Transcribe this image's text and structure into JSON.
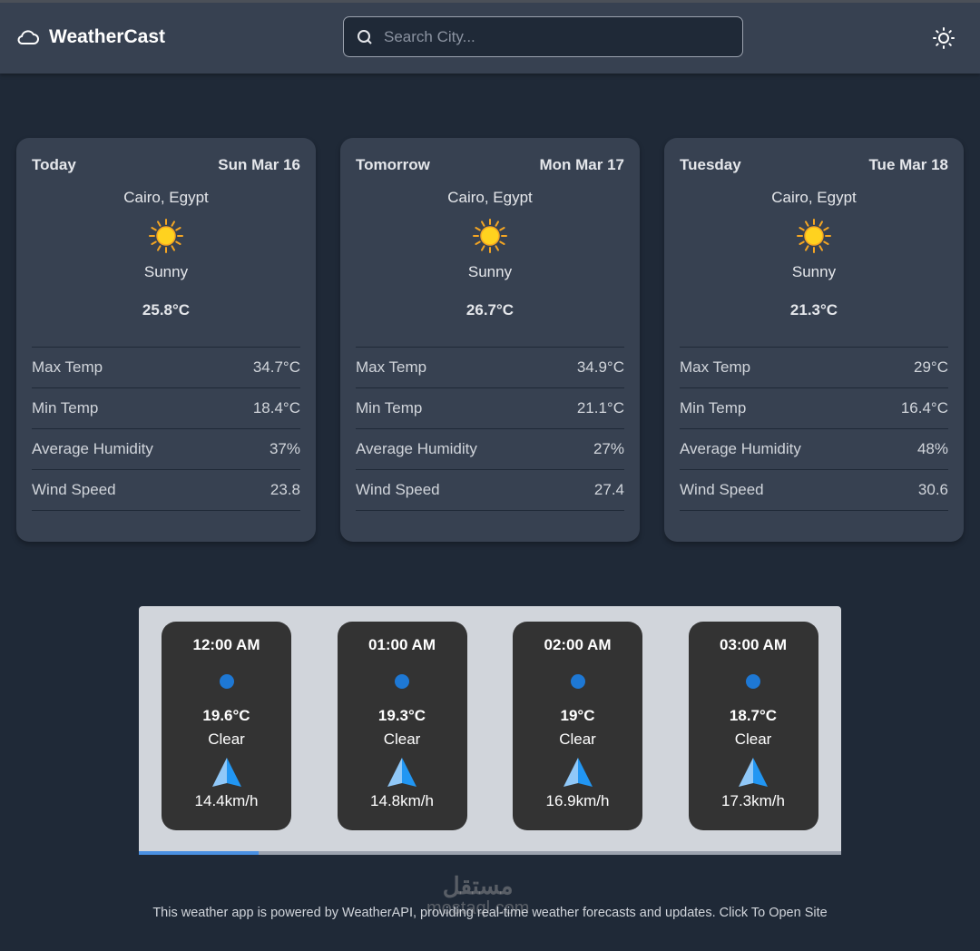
{
  "header": {
    "title": "WeatherCast",
    "search_placeholder": "Search City...",
    "logo_icon": "cloud-icon",
    "theme_icon": "sun-icon"
  },
  "forecast": [
    {
      "day": "Today",
      "date": "Sun Mar 16",
      "location": "Cairo, Egypt",
      "condition": "Sunny",
      "temp": "25.8°C",
      "rows": [
        {
          "label": "Max Temp",
          "value": "34.7°C"
        },
        {
          "label": "Min Temp",
          "value": "18.4°C"
        },
        {
          "label": "Average Humidity",
          "value": "37%"
        },
        {
          "label": "Wind Speed",
          "value": "23.8"
        }
      ]
    },
    {
      "day": "Tomorrow",
      "date": "Mon Mar 17",
      "location": "Cairo, Egypt",
      "condition": "Sunny",
      "temp": "26.7°C",
      "rows": [
        {
          "label": "Max Temp",
          "value": "34.9°C"
        },
        {
          "label": "Min Temp",
          "value": "21.1°C"
        },
        {
          "label": "Average Humidity",
          "value": "27%"
        },
        {
          "label": "Wind Speed",
          "value": "27.4"
        }
      ]
    },
    {
      "day": "Tuesday",
      "date": "Tue Mar 18",
      "location": "Cairo, Egypt",
      "condition": "Sunny",
      "temp": "21.3°C",
      "rows": [
        {
          "label": "Max Temp",
          "value": "29°C"
        },
        {
          "label": "Min Temp",
          "value": "16.4°C"
        },
        {
          "label": "Average Humidity",
          "value": "48%"
        },
        {
          "label": "Wind Speed",
          "value": "30.6"
        }
      ]
    }
  ],
  "hourly": [
    {
      "time": "12:00 AM",
      "temp": "19.6°C",
      "condition": "Clear",
      "wind": "14.4km/h"
    },
    {
      "time": "01:00 AM",
      "temp": "19.3°C",
      "condition": "Clear",
      "wind": "14.8km/h"
    },
    {
      "time": "02:00 AM",
      "temp": "19°C",
      "condition": "Clear",
      "wind": "16.9km/h"
    },
    {
      "time": "03:00 AM",
      "temp": "18.7°C",
      "condition": "Clear",
      "wind": "17.3km/h"
    }
  ],
  "hourly_scroll_fraction": 0.17,
  "footer": {
    "text": "This weather app is powered by WeatherAPI, providing real-time weather forecasts and updates. Click To Open Site"
  },
  "watermark": "مستقل mostaql.com"
}
